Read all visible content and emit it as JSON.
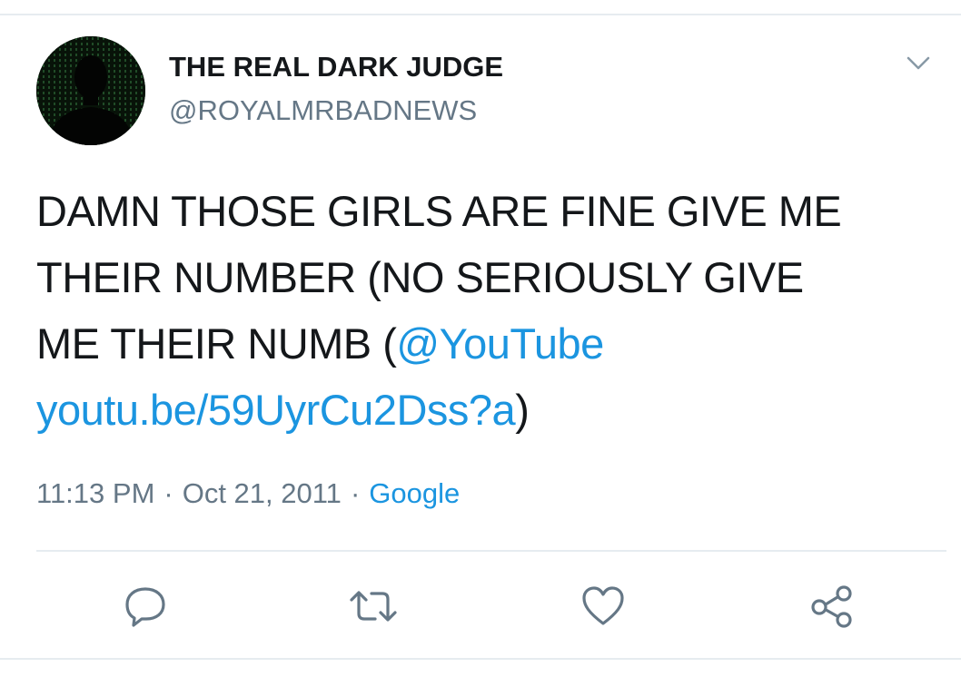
{
  "tweet": {
    "display_name": "THE REAL DARK JUDGE",
    "handle": "@ROYALMRBADNEWS",
    "text_line1": "DAMN THOSE GIRLS ARE FINE GIVE ME",
    "text_line2": "THEIR NUMBER (NO SERIOUSLY GIVE",
    "text_line3_prefix": "ME THEIR NUMB (",
    "mention": "@YouTube",
    "url": "youtu.be/59UyrCu2Dss?a",
    "text_suffix": ")",
    "time": "11:13 PM",
    "separator": "·",
    "date": "Oct 21, 2011",
    "source": "Google"
  },
  "icons": {
    "caret": "chevron-down-icon",
    "reply": "reply-icon",
    "retweet": "retweet-icon",
    "like": "heart-icon",
    "share": "share-icon"
  },
  "colors": {
    "text": "#14171a",
    "secondary": "#657786",
    "link": "#1b95e0",
    "divider": "#e6ecf0"
  }
}
